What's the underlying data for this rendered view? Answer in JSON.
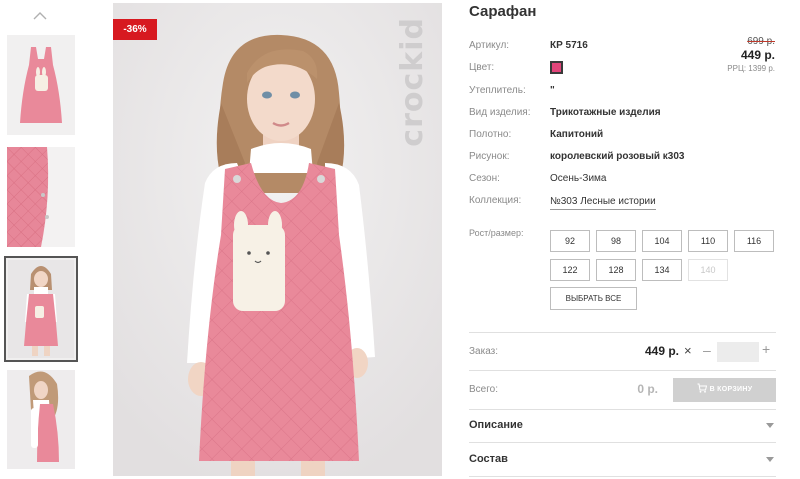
{
  "product": {
    "title": "Сарафан",
    "discount_badge": "-36%",
    "brand": "crockid"
  },
  "thumbnails": [
    {
      "name": "thumb-dress-front",
      "selected": false
    },
    {
      "name": "thumb-fabric-detail",
      "selected": false
    },
    {
      "name": "thumb-girl-front",
      "selected": true
    },
    {
      "name": "thumb-girl-side",
      "selected": false
    }
  ],
  "attributes": {
    "article_label": "Артикул:",
    "article_value": "КР 5716",
    "color_label": "Цвет:",
    "color_swatch": "#e2457a",
    "insulation_label": "Утеплитель:",
    "insulation_value": "\"",
    "type_label": "Вид изделия:",
    "type_value": "Трикотажные изделия",
    "fabric_label": "Полотно:",
    "fabric_value": "Капитоний",
    "pattern_label": "Рисунок:",
    "pattern_value": "королевский розовый к303",
    "season_label": "Сезон:",
    "season_value": "Осень-Зима",
    "collection_label": "Коллекция:",
    "collection_value": "№303 Лесные истории"
  },
  "prices": {
    "old": "699 р.",
    "current": "449 р.",
    "rrp": "РРЦ: 1399 р."
  },
  "sizes": {
    "label": "Рост/размер:",
    "options": [
      {
        "value": "92",
        "available": true
      },
      {
        "value": "98",
        "available": true
      },
      {
        "value": "104",
        "available": true
      },
      {
        "value": "110",
        "available": true
      },
      {
        "value": "116",
        "available": true
      },
      {
        "value": "122",
        "available": true
      },
      {
        "value": "128",
        "available": true
      },
      {
        "value": "134",
        "available": true
      },
      {
        "value": "140",
        "available": false
      }
    ],
    "select_all": "ВЫБРАТЬ ВСЕ"
  },
  "order": {
    "label": "Заказ:",
    "price": "449 р.",
    "multiply": "×",
    "minus": "–",
    "plus": "+",
    "quantity": ""
  },
  "total": {
    "label": "Всего:",
    "value": "0 р.",
    "cart_button": "В КОРЗИНУ"
  },
  "accordions": [
    {
      "label": "Описание"
    },
    {
      "label": "Состав"
    }
  ],
  "colors": {
    "dress_pink": "#e9899a",
    "accent_red": "#d71920",
    "disabled_button": "#d0d0d0"
  }
}
